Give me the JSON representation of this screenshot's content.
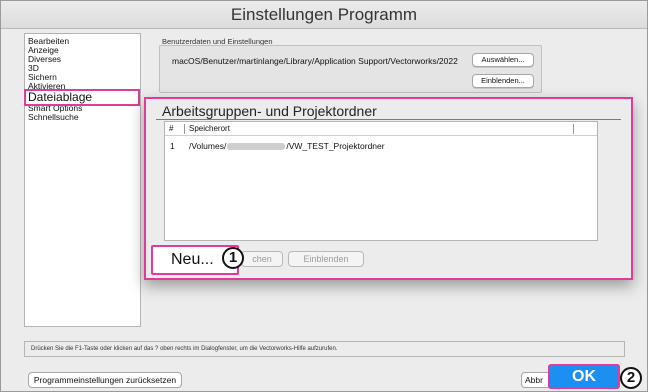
{
  "window": {
    "title": "Einstellungen Programm"
  },
  "sidebar": {
    "items": [
      {
        "label": "Bearbeiten"
      },
      {
        "label": "Anzeige"
      },
      {
        "label": "Diverses"
      },
      {
        "label": "3D"
      },
      {
        "label": "Sichern"
      },
      {
        "label": "Aktivieren"
      },
      {
        "label": "Dateiablage",
        "selected": true
      },
      {
        "label": "Smart Options"
      },
      {
        "label": "Schnellsuche"
      }
    ]
  },
  "userdata": {
    "section_label": "Benutzerdaten und Einstellungen",
    "path": "macOS/Benutzer/martinlange/Library/Application Support/Vectorworks/2022",
    "choose_button": "Auswählen...",
    "reveal_button": "Einblenden..."
  },
  "workgroup": {
    "title": "Arbeitsgruppen- und Projektordner",
    "columns": [
      "#",
      "Speicherort"
    ],
    "rows": [
      {
        "num": "1",
        "path_start": "/Volumes/",
        "path_end": "/VW_TEST_Projektordner"
      }
    ],
    "new_button": "Neu...",
    "delete_button_partial": "chen",
    "reveal_button": "Einblenden"
  },
  "help_text": "Drücken Sie die F1-Taste oder klicken auf das ? oben rechts im Dialogfenster, um die Vectorworks-Hilfe aufzurufen.",
  "footer": {
    "reset_button": "Programmeinstellungen zurücksetzen",
    "cancel_button_partial": "Abbr",
    "ok_button": "OK"
  },
  "callouts": [
    "1",
    "2"
  ],
  "colors": {
    "highlight": "#e03c97",
    "ok_blue": "#1d8ff3",
    "window_bg": "#ececec"
  }
}
